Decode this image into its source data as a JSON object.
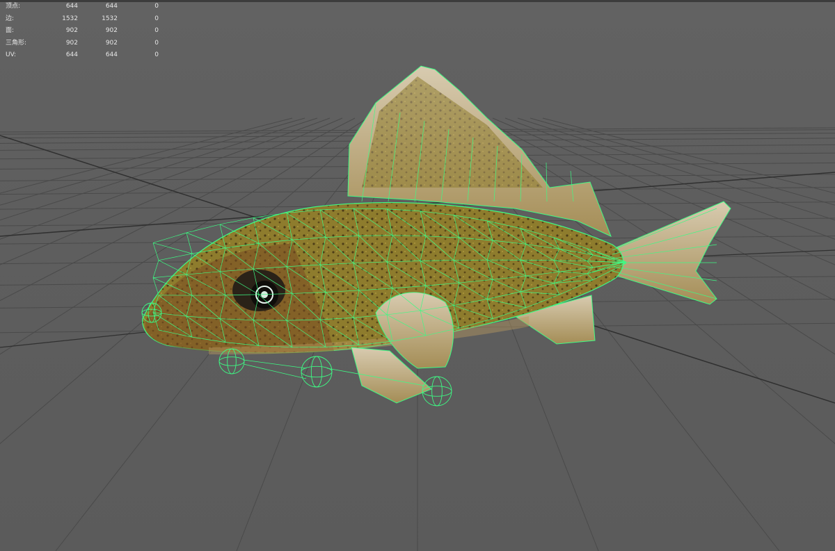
{
  "app": {
    "panel": "poly-count-hud"
  },
  "hud": {
    "rows": [
      {
        "label": "顶点:",
        "v1": "644",
        "v2": "644",
        "v3": "0"
      },
      {
        "label": "边:",
        "v1": "1532",
        "v2": "1532",
        "v3": "0"
      },
      {
        "label": "面:",
        "v1": "902",
        "v2": "902",
        "v3": "0"
      },
      {
        "label": "三角形:",
        "v1": "902",
        "v2": "902",
        "v3": "0"
      },
      {
        "label": "UV:",
        "v1": "644",
        "v2": "644",
        "v3": "0"
      }
    ]
  },
  "scene": {
    "grid": {
      "visible": true,
      "color": "#4a4a4a",
      "axis_color": "#303030"
    },
    "model": {
      "name": "fish",
      "display": "textured-wireframe",
      "wire_color": "#3dfb84",
      "body_color": "#8c7a2c",
      "fin_color": "#cfbfa0"
    }
  }
}
